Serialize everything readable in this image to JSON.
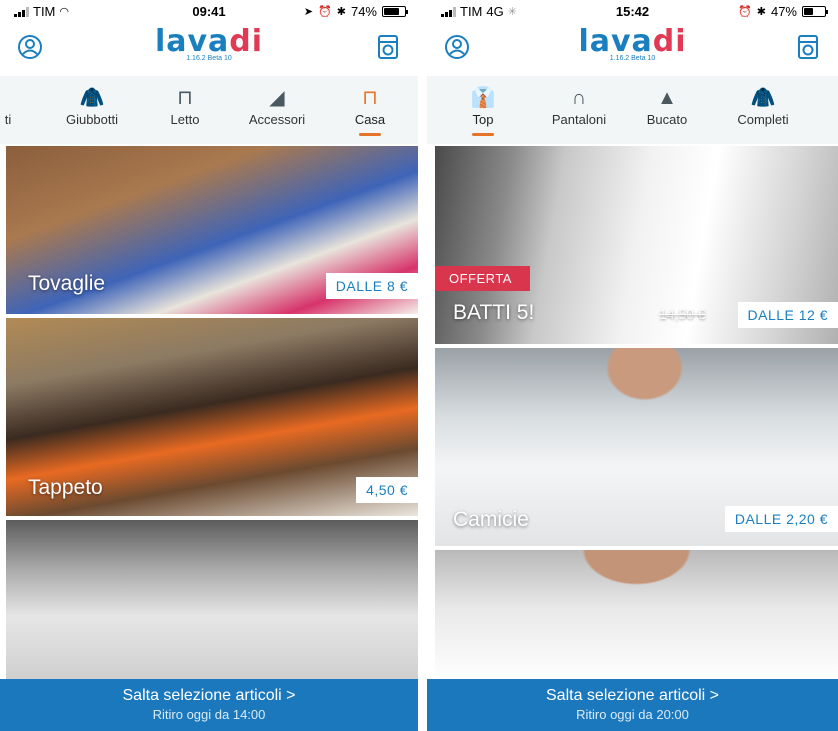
{
  "left": {
    "status": {
      "carrier": "TIM",
      "time": "09:41",
      "battery": "74%",
      "battery_level": 0.74
    },
    "logo": {
      "part1": "lava",
      "part2": "di",
      "version": "1.16.2 Beta 10"
    },
    "tabs": [
      {
        "label": "ti",
        "icon": "partial-icon"
      },
      {
        "label": "Giubbotti",
        "icon": "jacket-icon"
      },
      {
        "label": "Letto",
        "icon": "bed-icon"
      },
      {
        "label": "Accessori",
        "icon": "tie-icon"
      },
      {
        "label": "Casa",
        "icon": "table-icon",
        "active": true
      }
    ],
    "cards": [
      {
        "title": "Tovaglie",
        "price": "DALLE 8 €"
      },
      {
        "title": "Tappeto",
        "price": "4,50 €"
      },
      {
        "title": "",
        "price": ""
      }
    ],
    "footer": {
      "main": "Salta selezione articoli >",
      "sub": "Ritiro oggi da 14:00"
    }
  },
  "right": {
    "status": {
      "carrier": "TIM",
      "network": "4G",
      "time": "15:42",
      "battery": "47%",
      "battery_level": 0.47
    },
    "logo": {
      "part1": "lava",
      "part2": "di",
      "version": "1.16.2 Beta 10"
    },
    "tabs": [
      {
        "label": "Top",
        "icon": "shirt-icon",
        "active": true
      },
      {
        "label": "Pantaloni",
        "icon": "trousers-icon"
      },
      {
        "label": "Bucato",
        "icon": "laundry-bag-icon"
      },
      {
        "label": "Completi",
        "icon": "suit-icon"
      }
    ],
    "cards": [
      {
        "title": "BATTI 5!",
        "offer": "OFFERTA",
        "old_price": "14,50 €",
        "price": "DALLE 12 €"
      },
      {
        "title": "Camicie",
        "price": "DALLE 2,20 €"
      },
      {
        "title": "",
        "price": ""
      }
    ],
    "footer": {
      "main": "Salta selezione articoli >",
      "sub": "Ritiro oggi da 20:00"
    }
  },
  "colors": {
    "brand_blue": "#1b78bd",
    "brand_red": "#e03a55",
    "accent_orange": "#e5742a",
    "offer_red": "#d9364d"
  }
}
